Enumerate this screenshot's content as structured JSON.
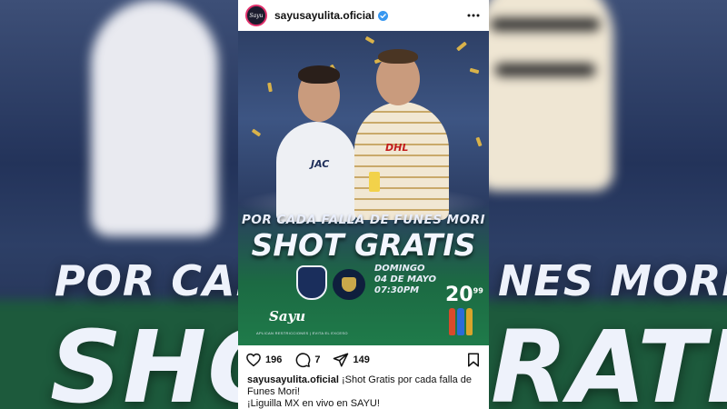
{
  "post": {
    "username": "sayusayulita.oficial",
    "verified": true,
    "avatar_text": "Sayu",
    "menu_icon": "more-horizontal-icon"
  },
  "poster": {
    "headline_line1": "POR CADA FALLA DE FUNES MORI",
    "headline_line2": "SHOT GRATIS",
    "date_line1": "DOMINGO",
    "date_line2": "04 DE MAYO",
    "date_line3": "07:30PM",
    "price": "20",
    "price_cents": "99",
    "logo_text": "Sayu",
    "disclaimer": "APLICAN RESTRICCIONES | EVITA EL EXCESO",
    "jersey_sponsor_left": "JAC",
    "jersey_sponsor_right": "DHL"
  },
  "background": {
    "word_top": "POR CADA",
    "word_right": "NES MORI",
    "word_bottom_left": "SHOT",
    "word_bottom_right": "RATIS"
  },
  "actions": {
    "likes": "196",
    "comments": "7",
    "shares": "149"
  },
  "caption": {
    "user": "sayusayulita.oficial",
    "text": "¡Shot Gratis por cada falla de Funes Mori!",
    "text2": "¡Liguilla MX en vivo en SAYU!"
  },
  "colors": {
    "verified_blue": "#3897f0",
    "poster_navy": "#2e4066",
    "pitch_green": "#1f7b4a",
    "confetti_gold": "#d9b24a"
  }
}
